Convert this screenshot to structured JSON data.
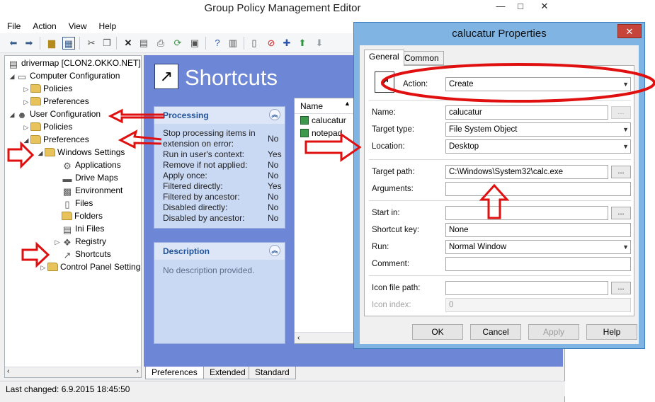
{
  "window": {
    "title": "Group Policy Management Editor",
    "minimize": "—",
    "maximize": "□",
    "close": "✕"
  },
  "menu": [
    "File",
    "Action",
    "View",
    "Help"
  ],
  "tree": [
    {
      "label": "drivermap [CLON2.OKKO.NET]",
      "icon": "gpo-icon",
      "level": 0,
      "twisty": ""
    },
    {
      "label": "Computer Configuration",
      "icon": "computer-icon",
      "level": 0,
      "twisty": "◢"
    },
    {
      "label": "Policies",
      "icon": "folder-icon",
      "level": 1,
      "twisty": "▷"
    },
    {
      "label": "Preferences",
      "icon": "folder-icon",
      "level": 1,
      "twisty": "▷"
    },
    {
      "label": "User Configuration",
      "icon": "user-icon",
      "level": 0,
      "twisty": "◢"
    },
    {
      "label": "Policies",
      "icon": "folder-icon",
      "level": 1,
      "twisty": "▷"
    },
    {
      "label": "Preferences",
      "icon": "folder-icon",
      "level": 1,
      "twisty": "◢"
    },
    {
      "label": "Windows Settings",
      "icon": "folder-icon",
      "level": 2,
      "twisty": "◢"
    },
    {
      "label": "Applications",
      "icon": "applications-icon",
      "level": 3,
      "twisty": ""
    },
    {
      "label": "Drive Maps",
      "icon": "drive-maps-icon",
      "level": 3,
      "twisty": ""
    },
    {
      "label": "Environment",
      "icon": "environment-icon",
      "level": 3,
      "twisty": ""
    },
    {
      "label": "Files",
      "icon": "files-icon",
      "level": 3,
      "twisty": ""
    },
    {
      "label": "Folders",
      "icon": "folders-icon",
      "level": 3,
      "twisty": ""
    },
    {
      "label": "Ini Files",
      "icon": "ini-files-icon",
      "level": 3,
      "twisty": ""
    },
    {
      "label": "Registry",
      "icon": "registry-icon",
      "level": 3,
      "twisty": "▷"
    },
    {
      "label": "Shortcuts",
      "icon": "shortcuts-icon",
      "level": 3,
      "twisty": ""
    },
    {
      "label": "Control Panel Setting",
      "icon": "control-panel-icon",
      "level": 2,
      "twisty": "▷"
    }
  ],
  "pane": {
    "title": "Shortcuts",
    "processing": {
      "header": "Processing",
      "rows": [
        {
          "k": "Stop processing items in extension on error:",
          "v": "No"
        },
        {
          "k": "Run in user's context:",
          "v": "Yes"
        },
        {
          "k": "Remove if not applied:",
          "v": "No"
        },
        {
          "k": "Apply once:",
          "v": "No"
        },
        {
          "k": "Filtered directly:",
          "v": "Yes"
        },
        {
          "k": "Filtered by ancestor:",
          "v": "No"
        },
        {
          "k": "Disabled directly:",
          "v": "No"
        },
        {
          "k": "Disabled by ancestor:",
          "v": "No"
        }
      ]
    },
    "description": {
      "header": "Description",
      "text": "No description provided."
    },
    "list": {
      "header": "Name",
      "items": [
        "calucatur",
        "notepad"
      ]
    },
    "tabs": [
      "Preferences",
      "Extended",
      "Standard"
    ]
  },
  "status": "Last changed: 6.9.2015 18:45:50",
  "dialog": {
    "title": "calucatur Properties",
    "close": "✕",
    "tabs": [
      "General",
      "Common"
    ],
    "action_label": "Action:",
    "action_value": "Create",
    "name_label": "Name:",
    "name_value": "calucatur",
    "target_type_label": "Target type:",
    "target_type_value": "File System Object",
    "location_label": "Location:",
    "location_value": "Desktop",
    "target_path_label": "Target path:",
    "target_path_value": "C:\\Windows\\System32\\calc.exe",
    "arguments_label": "Arguments:",
    "arguments_value": "",
    "start_in_label": "Start in:",
    "start_in_value": "",
    "shortcut_key_label": "Shortcut key:",
    "shortcut_key_value": "None",
    "run_label": "Run:",
    "run_value": "Normal Window",
    "comment_label": "Comment:",
    "comment_value": "",
    "icon_path_label": "Icon file path:",
    "icon_path_value": "",
    "icon_index_label": "Icon index:",
    "icon_index_value": "0",
    "browse": "...",
    "ok": "OK",
    "cancel": "Cancel",
    "apply": "Apply",
    "help": "Help"
  },
  "colors": {
    "pane_bg": "#6d87d6",
    "annotation_red": "#e01010",
    "dialog_frame": "#7fb4e3"
  }
}
